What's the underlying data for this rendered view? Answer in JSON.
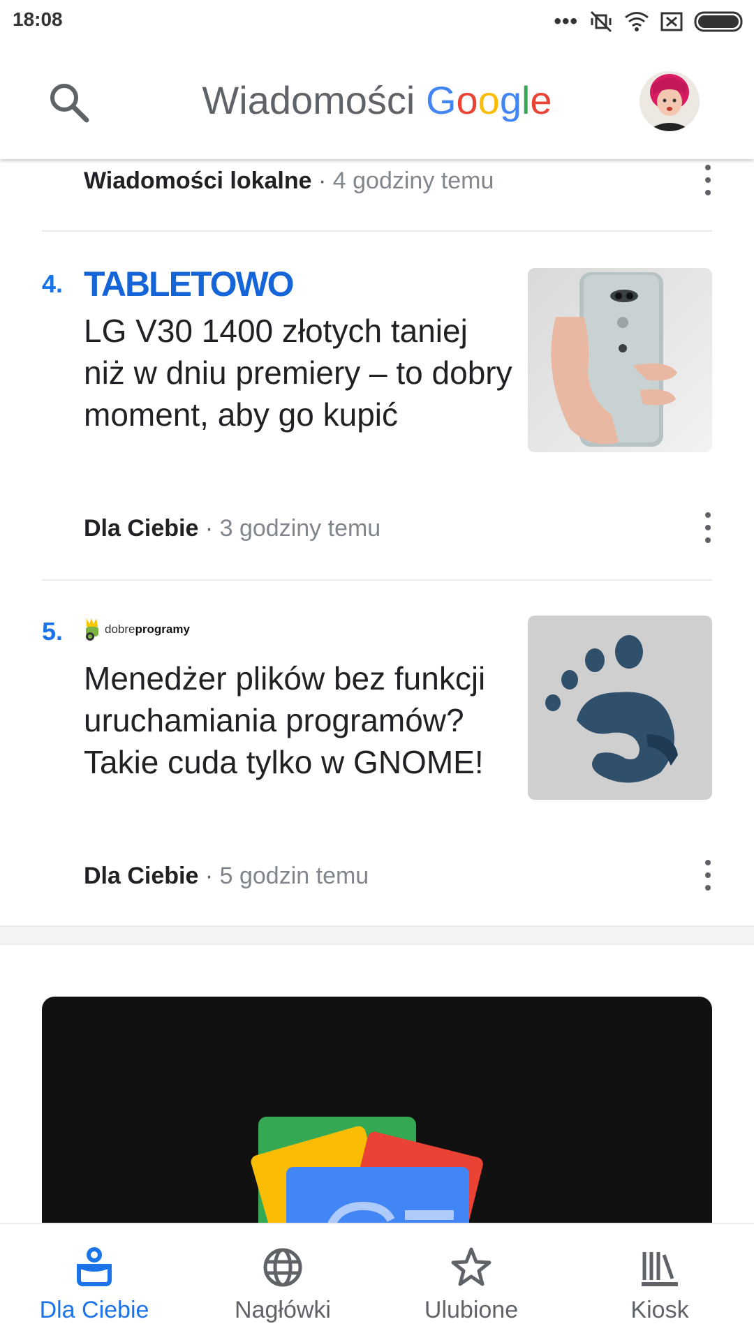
{
  "status_bar": {
    "time": "18:08"
  },
  "header": {
    "title_word": "Wiadomości",
    "brand_letters": [
      "G",
      "o",
      "o",
      "g",
      "l",
      "e"
    ]
  },
  "feed": {
    "top_meta": {
      "source": "Wiadomości lokalne",
      "separator": "·",
      "time": "4 godziny temu"
    },
    "articles": [
      {
        "rank": "4.",
        "publisher": "TABLETOWO",
        "headline": "LG V30 1400 złotych taniej niż w dniu premiery – to dobry moment, aby go kupić",
        "source": "Dla Ciebie",
        "separator": "·",
        "time": "3 godziny temu"
      },
      {
        "rank": "5.",
        "publisher_a": "dobre",
        "publisher_b": "programy",
        "headline": "Menedżer plików bez funkcji uruchamiania programów? Takie cuda tylko w GNOME!",
        "source": "Dla Ciebie",
        "separator": "·",
        "time": "5 godzin temu"
      }
    ]
  },
  "bottom_nav": {
    "items": [
      {
        "label": "Dla Ciebie",
        "icon": "for-you-icon",
        "active": true
      },
      {
        "label": "Nagłówki",
        "icon": "globe-icon",
        "active": false
      },
      {
        "label": "Ulubione",
        "icon": "star-icon",
        "active": false
      },
      {
        "label": "Kiosk",
        "icon": "newsstand-icon",
        "active": false
      }
    ]
  },
  "colors": {
    "accent": "#1a73e8",
    "tabletowo": "#1565d8",
    "promo_bg": "#111111"
  }
}
